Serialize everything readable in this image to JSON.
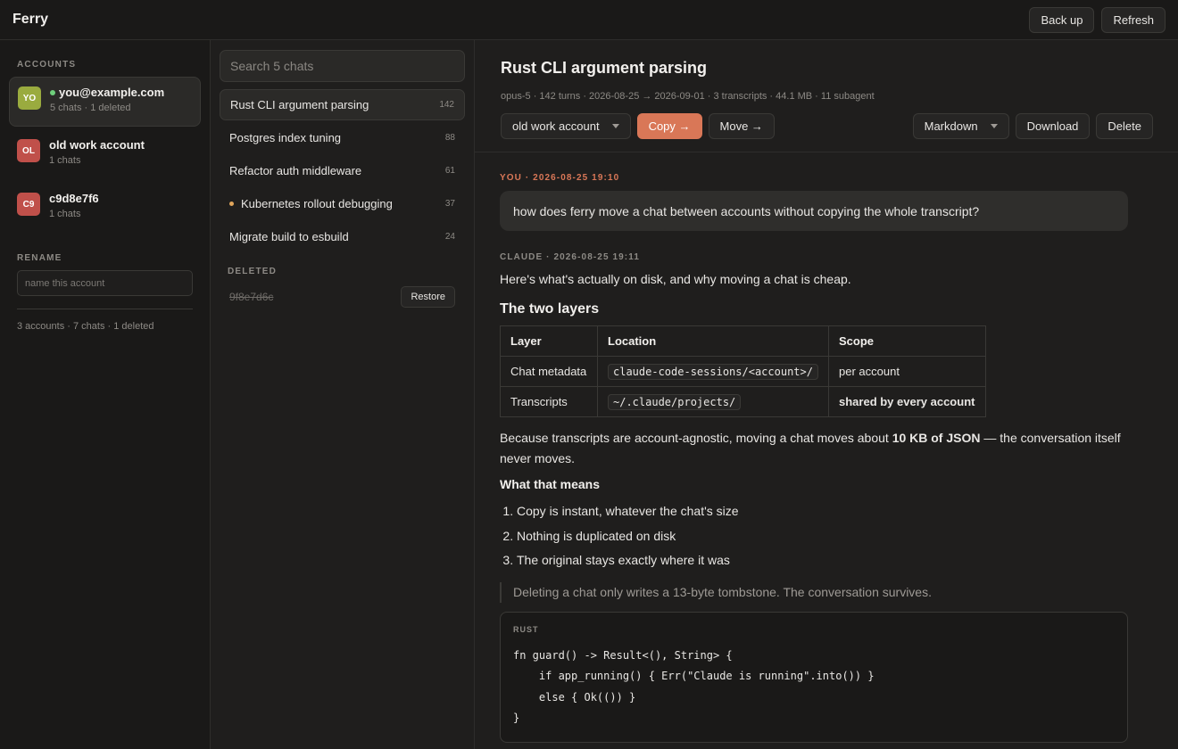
{
  "app": {
    "title": "Ferry"
  },
  "topbar": {
    "backup_label": "Back up",
    "refresh_label": "Refresh"
  },
  "accounts": {
    "section_label": "ACCOUNTS",
    "items": [
      {
        "initials": "YO",
        "name": "you@example.com",
        "sub": "5 chats · 1 deleted",
        "color": "#9aab3f",
        "active": true
      },
      {
        "initials": "OL",
        "name": "old work account",
        "sub": "1 chats",
        "color": "#c0504a",
        "active": false
      },
      {
        "initials": "C9",
        "name": "c9d8e7f6",
        "sub": "1 chats",
        "color": "#c0504a",
        "active": false
      }
    ],
    "rename_label": "RENAME",
    "rename_placeholder": "name this account",
    "footer": "3 accounts · 7 chats · 1 deleted"
  },
  "chats": {
    "search_placeholder": "Search 5 chats",
    "items": [
      {
        "title": "Rust CLI argument parsing",
        "count": "142"
      },
      {
        "title": "Postgres index tuning",
        "count": "88"
      },
      {
        "title": "Refactor auth middleware",
        "count": "61"
      },
      {
        "title": "Kubernetes rollout debugging",
        "count": "37"
      },
      {
        "title": "Migrate build to esbuild",
        "count": "24"
      }
    ],
    "deleted_label": "DELETED",
    "deleted_item": "9f8e7d6c",
    "restore_label": "Restore"
  },
  "main": {
    "title": "Rust CLI argument parsing",
    "meta": "opus-5 · 142 turns · 2026-08-25 → 2026-09-01 · 3 transcripts · 44.1 MB · 11 subagent",
    "account_select": "old work account",
    "copy_label": "Copy →",
    "move_label": "Move →",
    "format_select": "Markdown",
    "download_label": "Download",
    "delete_label": "Delete"
  },
  "transcript": {
    "user_label": "YOU · 2026-08-25 19:10",
    "user_message": "how does ferry move a chat between accounts without copying the whole transcript?",
    "claude_label": "CLAUDE · 2026-08-25 19:11",
    "intro": "Here's what's actually on disk, and why moving a chat is cheap.",
    "heading1": "The two layers",
    "table": {
      "headers": [
        "Layer",
        "Location",
        "Scope"
      ],
      "rows": [
        [
          "Chat metadata",
          "claude-code-sessions/<account>/",
          "per account"
        ],
        [
          "Transcripts",
          "~/.claude/projects/",
          "shared by every account"
        ]
      ]
    },
    "para_before": "Because transcripts are account-agnostic, moving a chat moves about ",
    "para_bold": "10 KB of JSON",
    "para_after": " — the conversation itself never moves.",
    "heading2": "What that means",
    "list": [
      "Copy is instant, whatever the chat's size",
      "Nothing is duplicated on disk",
      "The original stays exactly where it was"
    ],
    "quote": "Deleting a chat only writes a 13-byte tombstone. The conversation survives.",
    "code_lang": "RUST",
    "code": [
      "fn guard() -> Result<(), String> {",
      "    if app_running() { Err(\"Claude is running\".into()) }",
      "    else { Ok(()) }",
      "}"
    ]
  }
}
